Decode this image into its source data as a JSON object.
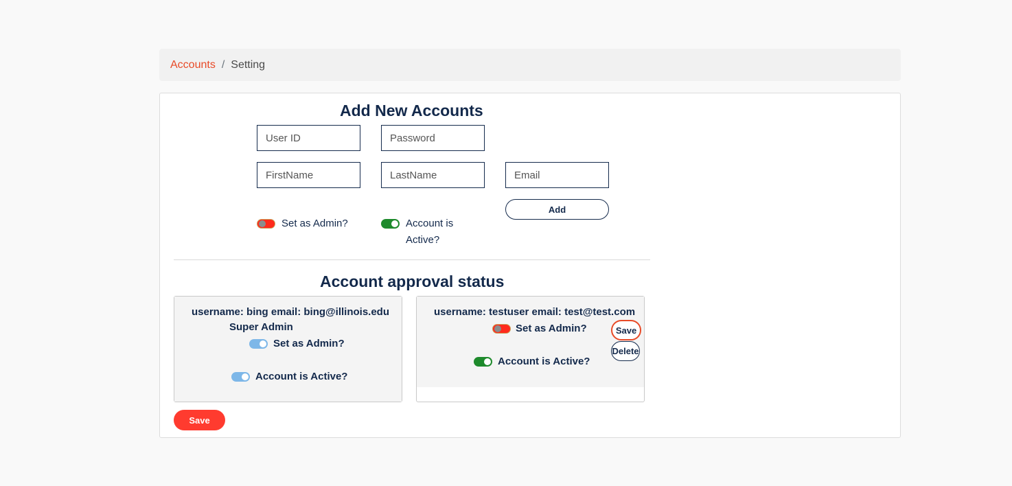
{
  "breadcrumb": {
    "link": "Accounts",
    "separator": "/",
    "current": "Setting"
  },
  "add_form": {
    "title": "Add New Accounts",
    "user_id_placeholder": "User ID",
    "password_placeholder": "Password",
    "firstname_placeholder": "FirstName",
    "lastname_placeholder": "LastName",
    "email_placeholder": "Email",
    "add_label": "Add",
    "admin_toggle_label": "Set as Admin?",
    "admin_toggle_on": false,
    "active_toggle_label_line1": "Account is",
    "active_toggle_label_line2": "Active?",
    "active_toggle_on": true
  },
  "approval": {
    "title": "Account approval status",
    "accounts": [
      {
        "info": "username: bing email: bing@illinois.edu",
        "role": "Super Admin",
        "admin_label": "Set as Admin?",
        "admin_on": true,
        "active_label": "Account is Active?",
        "active_on": true
      },
      {
        "info": "username: testuser email: test@test.com",
        "admin_label": "Set as Admin?",
        "admin_on": false,
        "active_label": "Account is Active?",
        "active_on": true,
        "save_label": "Save",
        "delete_label": "Delete"
      }
    ],
    "save_label": "Save"
  },
  "colors": {
    "accent": "#e84a27",
    "navy": "#13294b",
    "primary_button": "#ff3b2f",
    "toggle_off": "#ff2a1c",
    "toggle_on_green": "#1e8a2c",
    "toggle_on_disabled": "#7db7e8"
  }
}
